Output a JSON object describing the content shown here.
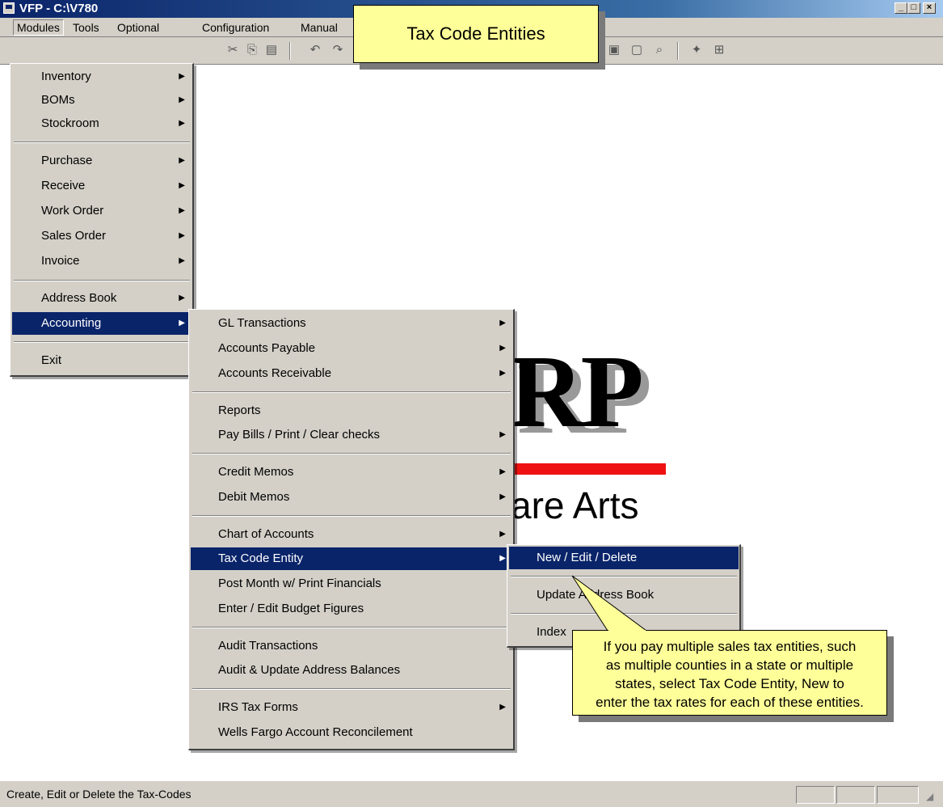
{
  "window": {
    "title": "VFP - C:\\V780"
  },
  "caption_buttons": {
    "minimize": "_",
    "maximize": "□",
    "close": "×"
  },
  "menubar": {
    "items": [
      "Modules",
      "Tools",
      "Optional",
      "Configuration",
      "Manual"
    ]
  },
  "callout_title": "Tax Code Entities",
  "toolbar": {
    "icons": [
      "cut-icon",
      "copy-icon",
      "paste-icon",
      "undo-icon",
      "redo-icon",
      "spell-icon",
      "grid-icon",
      "form-icon",
      "report-icon",
      "properties-icon",
      "preview-icon",
      "wizard-icon",
      "builder-icon"
    ],
    "combo_value": ""
  },
  "modules_menu": {
    "inventory": "Inventory",
    "boms": "BOMs",
    "stockroom": "Stockroom",
    "purchase": "Purchase",
    "receive": "Receive",
    "work_order": "Work Order",
    "sales_order": "Sales Order",
    "invoice": "Invoice",
    "address_book": "Address Book",
    "accounting": "Accounting",
    "exit": "Exit"
  },
  "accounting_menu": {
    "gl_transactions": "GL Transactions",
    "accounts_payable": "Accounts Payable",
    "accounts_receivable": "Accounts Receivable",
    "reports": "Reports",
    "pay_bills": "Pay Bills / Print / Clear checks",
    "credit_memos": "Credit Memos",
    "debit_memos": "Debit Memos",
    "chart_of_accounts": "Chart of Accounts",
    "tax_code_entity": "Tax Code Entity",
    "post_month": "Post Month w/ Print Financials",
    "budget": "Enter / Edit Budget Figures",
    "audit_transactions": "Audit Transactions",
    "audit_address": "Audit & Update Address Balances",
    "irs_tax_forms": "IRS Tax Forms",
    "wells_fargo": "Wells Fargo Account Reconcilement"
  },
  "tax_menu": {
    "new_edit_delete": "New / Edit / Delete",
    "update_address_book": "Update Address Book",
    "index": "Index"
  },
  "logo": {
    "letters": "RP",
    "tagline": "are Arts"
  },
  "tip": {
    "line1": "If you pay multiple sales tax entities, such",
    "line2": "as multiple counties in a state or multiple",
    "line3": "states, select Tax Code Entity, New to",
    "line4": "enter the tax rates for each of these entities."
  },
  "status": {
    "text": "Create, Edit or Delete the Tax-Codes"
  },
  "colors": {
    "highlight": "#0a246a",
    "menu_bg": "#d4d0c8",
    "callout": "#ffff99",
    "logo_red": "#e11111"
  }
}
